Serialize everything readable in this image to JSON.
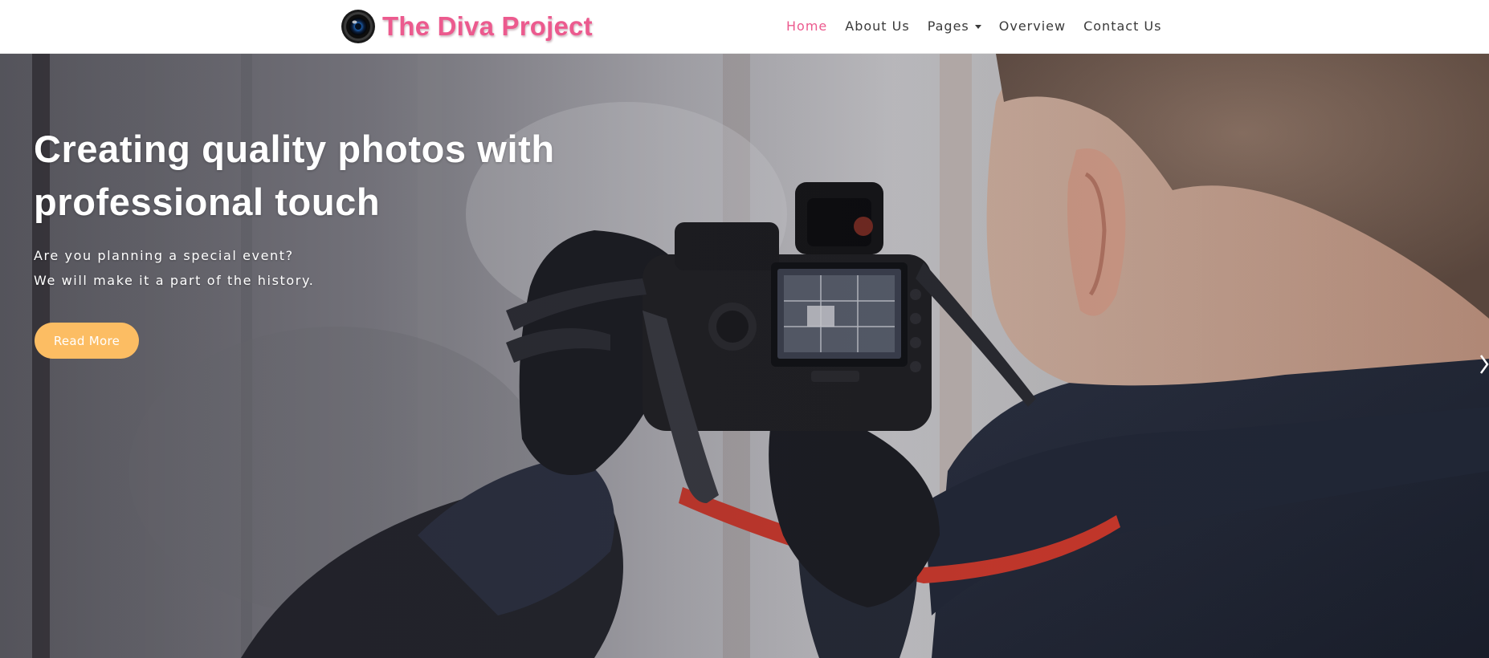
{
  "brand": {
    "name": "The Diva Project",
    "color": "#ec5a8e",
    "logo_icon": "camera-lens-icon"
  },
  "nav": {
    "items": [
      {
        "label": "Home",
        "active": true
      },
      {
        "label": "About Us",
        "active": false
      },
      {
        "label": "Pages",
        "active": false,
        "has_dropdown": true
      },
      {
        "label": "Overview",
        "active": false
      },
      {
        "label": "Contact Us",
        "active": false
      }
    ],
    "dropdown_icon": "caret-down-icon"
  },
  "hero": {
    "title_line1": "Creating quality photos with",
    "title_line2": "professional touch",
    "subtitle_line1": "Are you planning a special event?",
    "subtitle_line2": "We will make it a part of the history.",
    "button_label": "Read More",
    "button_color": "#fcbd63",
    "image_description_icon": "photographer-with-camera-image",
    "next_icon": "chevron-right-icon"
  }
}
